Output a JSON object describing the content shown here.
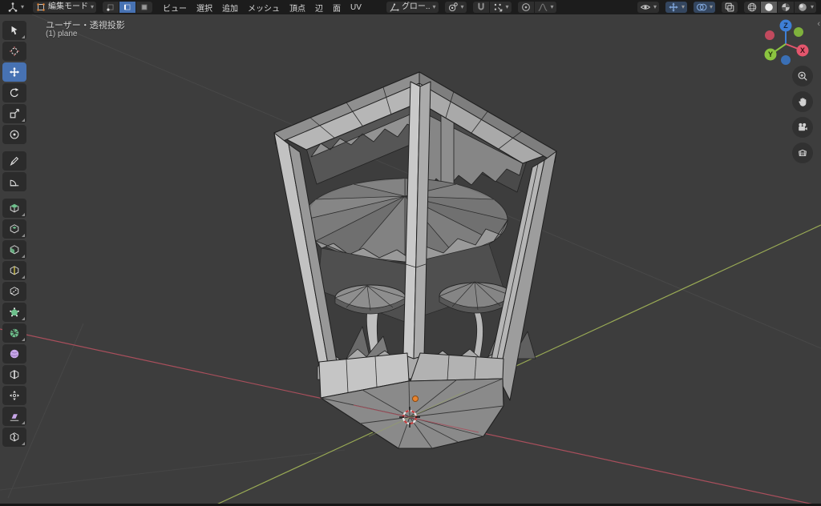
{
  "header": {
    "editor_type": "3d-viewport",
    "mode": {
      "label": "編集モード"
    },
    "select_modes": {
      "items": [
        "vertex",
        "edge",
        "face"
      ],
      "active": "edge"
    },
    "menus": [
      "ビュー",
      "選択",
      "追加",
      "メッシュ",
      "頂点",
      "辺",
      "面",
      "UV"
    ],
    "transform_orientation": {
      "label": "グロー.."
    },
    "pivot": "median-point",
    "snap": {
      "enabled": false
    },
    "proportional_editing": {
      "enabled": false
    },
    "right_toggles": {
      "object_type_visibility": true,
      "show_gizmos": true,
      "show_overlays": true,
      "xray": false
    },
    "shading": {
      "modes": [
        "wireframe",
        "solid",
        "material-preview",
        "rendered"
      ],
      "active": "solid"
    }
  },
  "viewport": {
    "overlay": {
      "view_label": "ユーザー・透視投影",
      "object_label": "(1) plane"
    },
    "gizmo": {
      "axis_x": "X",
      "axis_y": "Y",
      "axis_z": "Z"
    },
    "nav_buttons": [
      "zoom",
      "pan",
      "camera-view",
      "toggle-perspective"
    ],
    "sidebar_toggle": "‹",
    "scene_object": "lantern mesh with mushrooms (edit mode wireframe)",
    "colors": {
      "background": "#3d3d3d",
      "header": "#1c1c1c",
      "accent_blue": "#4772b3",
      "axis_x_line": "#a94f5c",
      "axis_y_line": "#9aab55",
      "gizmo_x": "#e4566d",
      "gizmo_y": "#8bc440",
      "gizmo_z": "#3e7fd6",
      "origin_orange": "#e8842f",
      "mesh_light": "#c2c2c2",
      "mesh_dark": "#4e4e4e"
    }
  },
  "toolbar": {
    "active_tool": "move",
    "tools": [
      "tweak",
      "cursor",
      "move",
      "rotate",
      "scale",
      "transform",
      "annotate",
      "measure",
      "extrude-region",
      "inset-faces",
      "bevel",
      "loop-cut",
      "knife",
      "poly-build",
      "spin",
      "smooth",
      "edge-slide",
      "shrink-fatten",
      "shear",
      "rip-region"
    ]
  }
}
